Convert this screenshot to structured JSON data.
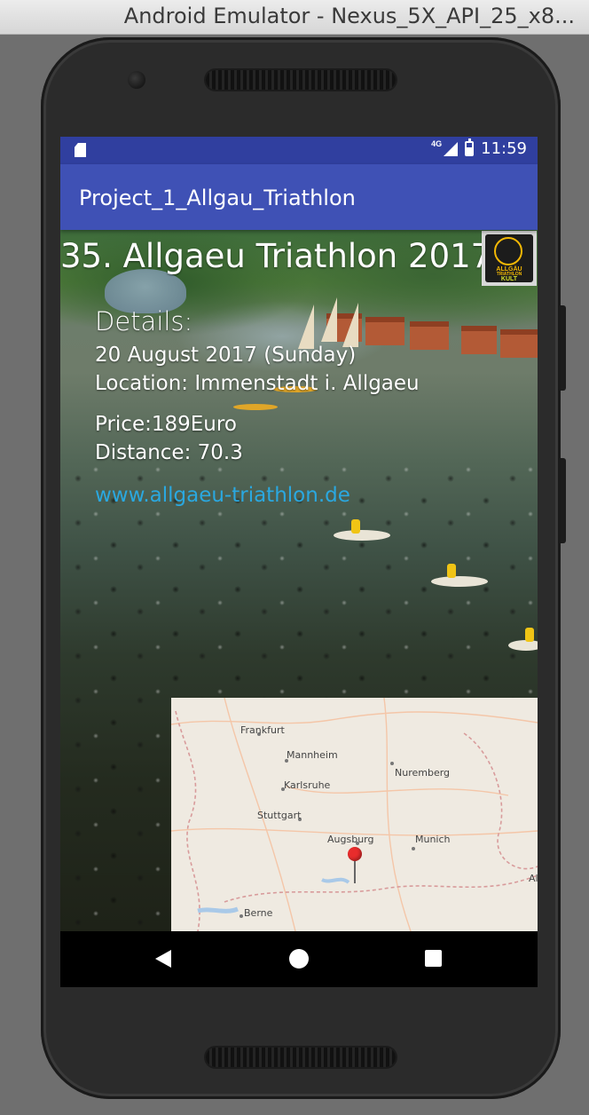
{
  "window": {
    "title": "Android Emulator - Nexus_5X_API_25_x8..."
  },
  "status_bar": {
    "network": "4G",
    "time": "11:59"
  },
  "app_bar": {
    "title": "Project_1_Allgau_Triathlon"
  },
  "event": {
    "title": "35. Allgaeu Triathlon 2017",
    "logo": {
      "line1": "ALLGÄU",
      "line2": "TRIATHLON",
      "line3": "KULT"
    },
    "details_heading": "Details:",
    "date": "20 August 2017 (Sunday)",
    "location": "Location: Immenstadt i. Allgaeu",
    "price": "Price:189Euro",
    "distance": "Distance: 70.3",
    "website": "www.allgaeu-triathlon.de"
  },
  "map": {
    "cities": [
      "Frankfurt",
      "Mannheim",
      "Nuremberg",
      "Karlsruhe",
      "Stuttgart",
      "Augsburg",
      "Munich",
      "Berne"
    ],
    "partial_label": "Al"
  },
  "colors": {
    "status_bar": "#303F9F",
    "app_bar": "#3F51B5",
    "link": "#2AA8E0",
    "marker": "#E82C2C"
  },
  "icons": {
    "sd_card": "sd-card-icon",
    "signal": "signal-icon",
    "battery": "battery-icon",
    "back": "back-icon",
    "home": "home-icon",
    "recents": "recents-icon"
  }
}
